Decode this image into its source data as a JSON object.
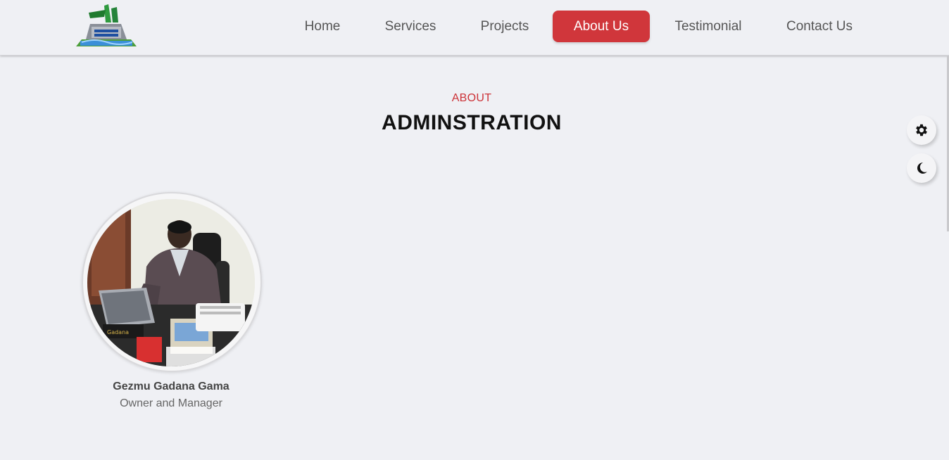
{
  "nav": {
    "items": [
      {
        "label": "Home",
        "active": false
      },
      {
        "label": "Services",
        "active": false
      },
      {
        "label": "Projects",
        "active": false
      },
      {
        "label": "About Us",
        "active": true
      },
      {
        "label": "Testimonial",
        "active": false
      },
      {
        "label": "Contact Us",
        "active": false
      }
    ]
  },
  "section": {
    "eyebrow": "ABOUT",
    "title": "ADMINSTRATION"
  },
  "team": [
    {
      "name": "Gezmu Gadana Gama",
      "role": "Owner and Manager"
    }
  ],
  "floating": {
    "settings_icon": "gear-icon",
    "theme_icon": "moon-icon"
  },
  "colors": {
    "accent": "#d0363b",
    "background": "#eff0f4"
  }
}
